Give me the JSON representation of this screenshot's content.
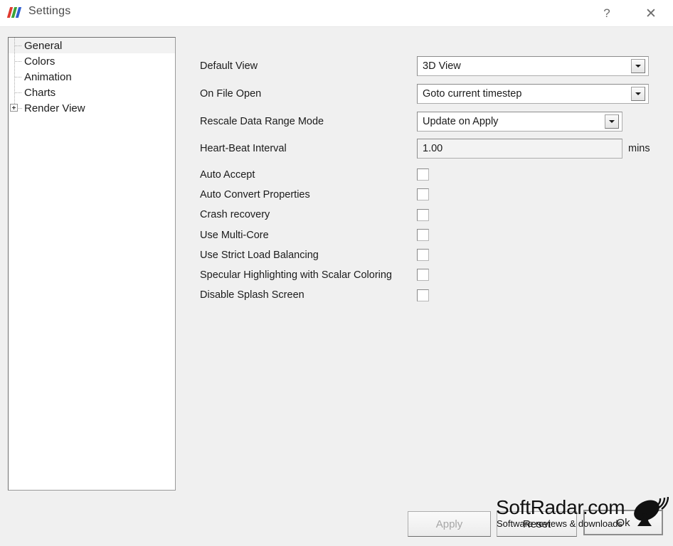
{
  "window": {
    "title": "Settings",
    "icon_name": "paraview-logo-icon",
    "logo_colors": [
      "#e03a2f",
      "#3aa33a",
      "#2f5fd0"
    ],
    "help_label": "?",
    "close_label": "✕"
  },
  "sidebar": {
    "items": [
      {
        "label": "General",
        "selected": true,
        "expandable": false
      },
      {
        "label": "Colors",
        "selected": false,
        "expandable": false
      },
      {
        "label": "Animation",
        "selected": false,
        "expandable": false
      },
      {
        "label": "Charts",
        "selected": false,
        "expandable": false
      },
      {
        "label": "Render View",
        "selected": false,
        "expandable": true
      }
    ]
  },
  "form": {
    "fields": [
      {
        "label": "Default View",
        "type": "combo",
        "value": "3D View"
      },
      {
        "label": "On File Open",
        "type": "combo",
        "value": "Goto current timestep"
      },
      {
        "label": "Rescale Data Range Mode",
        "type": "combo",
        "value": "Update on Apply"
      },
      {
        "label": "Heart-Beat Interval",
        "type": "text",
        "value": "1.00",
        "unit": "mins"
      }
    ],
    "checkboxes": [
      {
        "label": "Auto Accept",
        "checked": false
      },
      {
        "label": "Auto Convert Properties",
        "checked": false
      },
      {
        "label": "Crash recovery",
        "checked": false
      },
      {
        "label": "Use Multi-Core",
        "checked": false
      },
      {
        "label": "Use Strict Load Balancing",
        "checked": false
      },
      {
        "label": "Specular Highlighting with Scalar Coloring",
        "checked": false
      },
      {
        "label": "Disable Splash Screen",
        "checked": false
      }
    ]
  },
  "buttons": {
    "apply": {
      "label": "Apply",
      "disabled": true
    },
    "reset": {
      "label": "Reset",
      "disabled": false
    },
    "ok": {
      "label": "Ok",
      "disabled": false,
      "focused": true
    }
  },
  "watermark": {
    "title": "SoftRadar.com",
    "subtitle": "Software reviews & downloads",
    "icon_name": "satellite-dish-icon"
  }
}
